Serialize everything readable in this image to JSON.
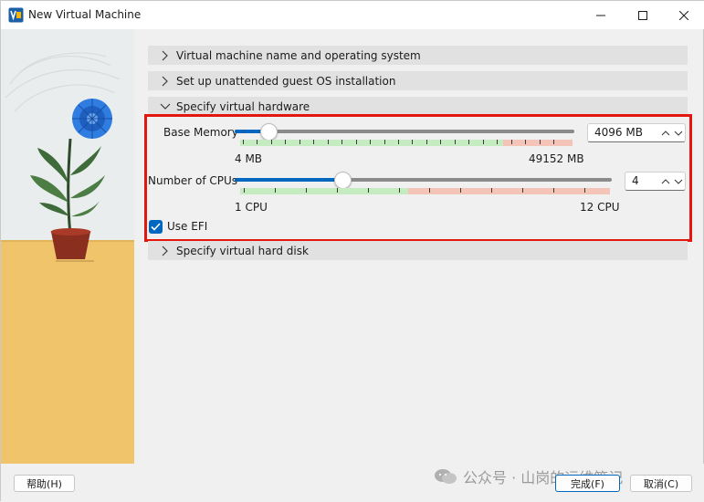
{
  "window": {
    "title": "New Virtual Machine",
    "icon": "virtualbox-icon",
    "controls": [
      "minimize-icon",
      "maximize-icon",
      "close-icon"
    ]
  },
  "sections": [
    {
      "label": "Virtual machine name and operating system",
      "expanded": false
    },
    {
      "label": "Set up unattended guest OS installation",
      "expanded": false
    },
    {
      "label": "Specify virtual hardware",
      "expanded": true
    },
    {
      "label": "Specify virtual hard disk",
      "expanded": false
    }
  ],
  "hardware": {
    "memory": {
      "label": "Base Memory",
      "value": "4096 MB",
      "min_label": "4 MB",
      "max_label": "49152 MB",
      "min": 4,
      "max": 49152,
      "current": 4096
    },
    "cpus": {
      "label": "Number of CPUs",
      "value": "4",
      "min_label": "1 CPU",
      "max_label": "12 CPU",
      "min": 1,
      "max": 12,
      "current": 4
    },
    "efi": {
      "label": "Use EFI",
      "checked": true
    }
  },
  "buttons": {
    "help": "帮助(H)",
    "finish": "完成(F)",
    "cancel": "取消(C)"
  },
  "watermark": "公众号 · 山岗的运维笔记",
  "colors": {
    "accent": "#0067c0",
    "highlight_border": "#e3170d",
    "range_green": "#c5ecc0",
    "range_red": "#f5c4b8",
    "section_bg": "#e1e1e1"
  }
}
